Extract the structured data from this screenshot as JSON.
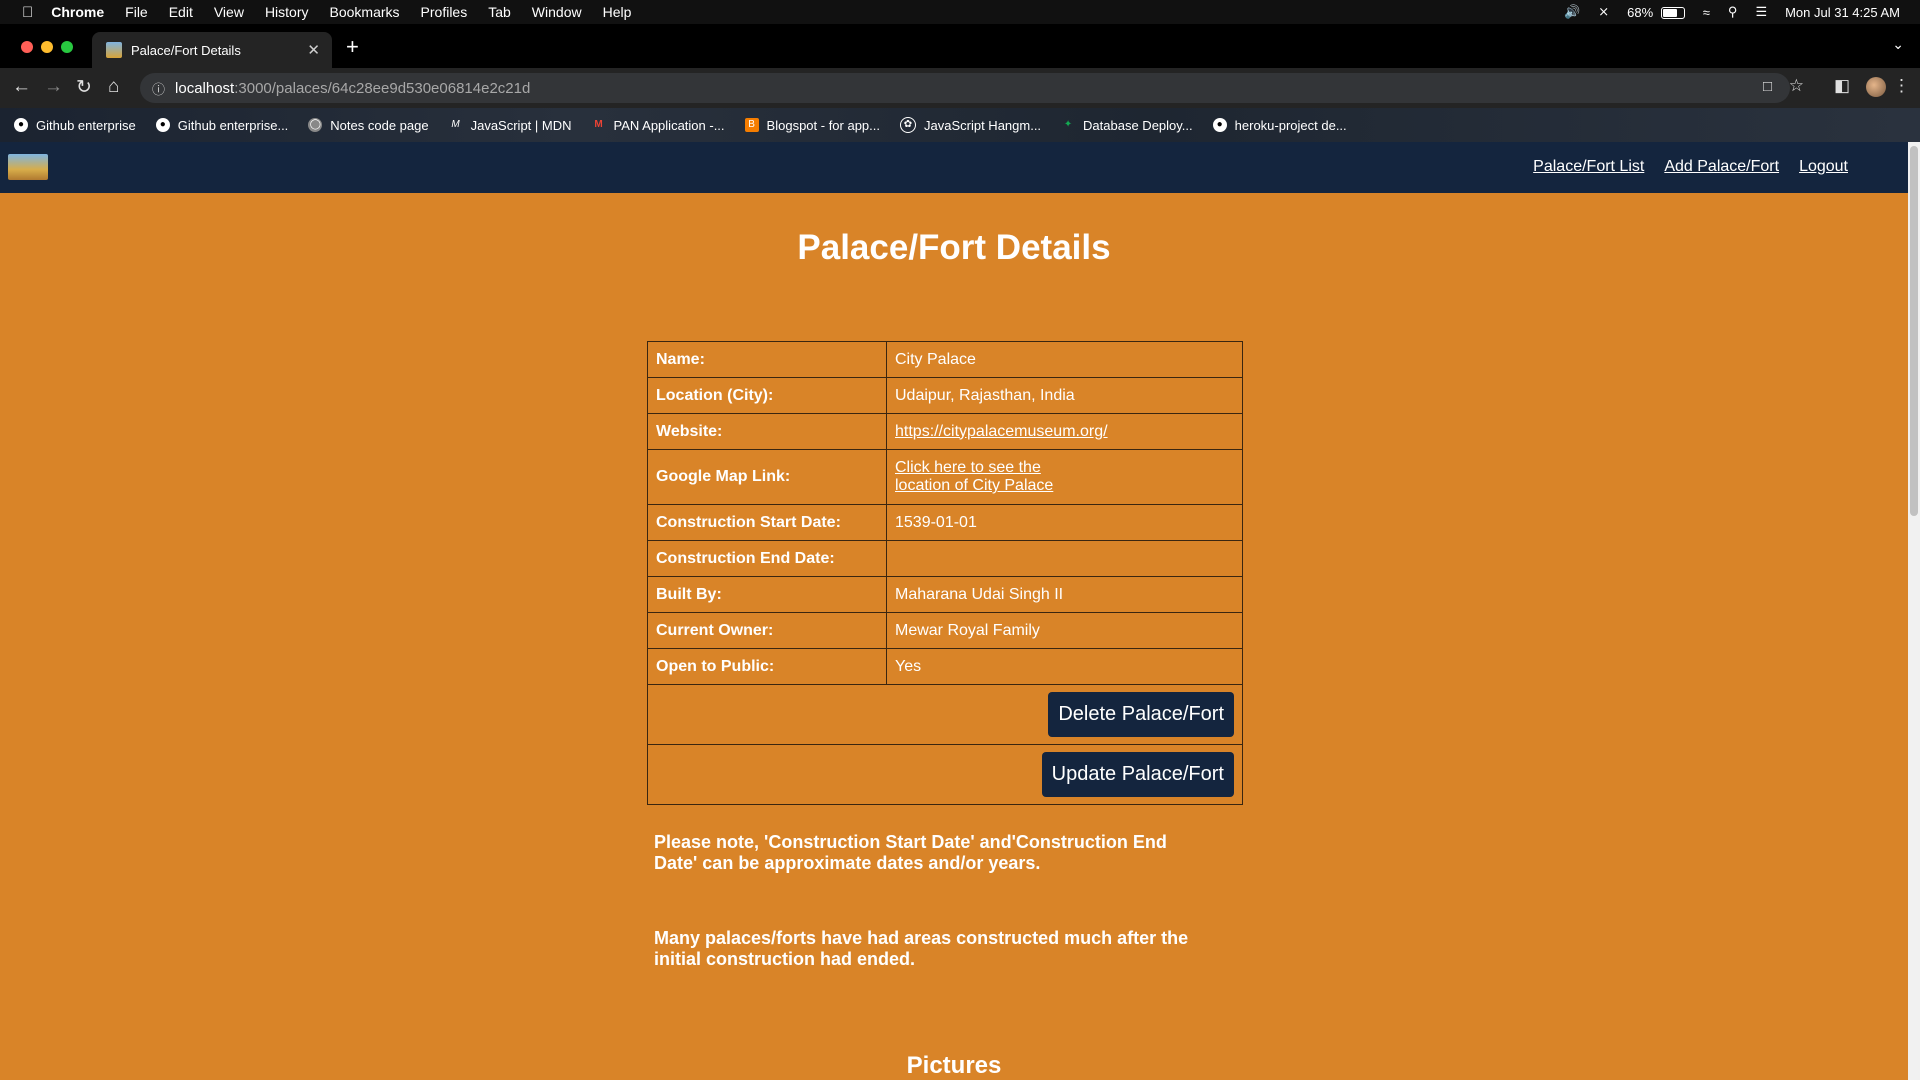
{
  "menubar": {
    "app": "Chrome",
    "items": [
      "File",
      "Edit",
      "View",
      "History",
      "Bookmarks",
      "Profiles",
      "Tab",
      "Window",
      "Help"
    ],
    "battery_percent": "68%",
    "battery_level": 0.68,
    "clock": "Mon Jul 31  4:25 AM"
  },
  "browser": {
    "tab_title": "Palace/Fort Details",
    "url_host": "localhost",
    "url_path": ":3000/palaces/64c28ee9d530e06814e2c21d",
    "bookmarks": [
      {
        "label": "Github enterprise",
        "icon": "github-icon"
      },
      {
        "label": "Github enterprise...",
        "icon": "github-icon"
      },
      {
        "label": "Notes code page",
        "icon": "globe-icon"
      },
      {
        "label": "JavaScript | MDN",
        "icon": "mdn-icon"
      },
      {
        "label": "PAN Application -...",
        "icon": "gmail-icon"
      },
      {
        "label": "Blogspot - for app...",
        "icon": "blogger-icon"
      },
      {
        "label": "JavaScript Hangm...",
        "icon": "chatgpt-icon"
      },
      {
        "label": "Database Deploy...",
        "icon": "mongodb-icon"
      },
      {
        "label": "heroku-project de...",
        "icon": "github-icon"
      }
    ]
  },
  "nav": {
    "links": [
      "Palace/Fort List",
      "Add Palace/Fort",
      "Logout"
    ]
  },
  "page": {
    "title": "Palace/Fort Details",
    "details": {
      "name_label": "Name:",
      "name_value": "City Palace",
      "location_label": "Location (City):",
      "location_value": "Udaipur, Rajasthan, India",
      "website_label": "Website:",
      "website_value": "https://citypalacemuseum.org/",
      "map_label": "Google Map Link:",
      "map_value_line1": "Click here to see the",
      "map_value_line2": "location of City Palace",
      "start_label": "Construction Start Date:",
      "start_value": "1539-01-01",
      "end_label": "Construction End Date:",
      "end_value": "",
      "built_label": "Built By:",
      "built_value": "Maharana Udai Singh II",
      "owner_label": "Current Owner:",
      "owner_value": "Mewar Royal Family",
      "public_label": "Open to Public:",
      "public_value": "Yes"
    },
    "delete_button": "Delete Palace/Fort",
    "update_button": "Update Palace/Fort",
    "note1": "Please note, 'Construction Start Date' and'Construction End Date' can be approximate dates and/or years.",
    "note2": "Many palaces/forts have had areas constructed much after the initial construction had ended.",
    "pictures_heading": "Pictures"
  },
  "colors": {
    "page_background": "#d98428",
    "navbar": "#14253e",
    "button": "#14253e"
  }
}
